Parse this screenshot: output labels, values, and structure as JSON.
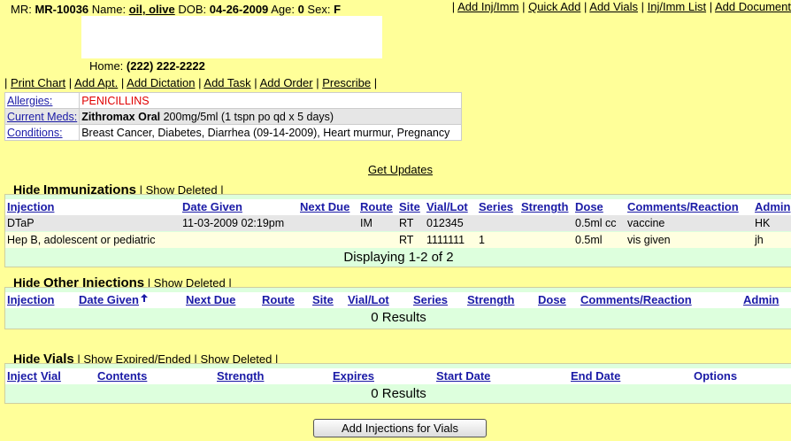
{
  "patient": {
    "mr_label": "MR:",
    "mr": "MR-10036",
    "name_label": "Name:",
    "name": "oil, olive",
    "dob_label": "DOB:",
    "dob": "04-26-2009",
    "age_label": "Age:",
    "age": "0",
    "sex_label": "Sex:",
    "sex": "F",
    "home_label": "Home:",
    "home": "(222) 222-2222"
  },
  "top_links": [
    "Add Inj/Imm",
    "Quick Add",
    "Add Vials",
    "Inj/Imm List",
    "Add Document"
  ],
  "action_links": [
    "Print Chart",
    "Add Apt.",
    "Add Dictation",
    "Add Task",
    "Add Order",
    "Prescribe"
  ],
  "info": {
    "allergies_label": "Allergies:",
    "allergies": "PENICILLINS",
    "meds_label": "Current Meds:",
    "meds_name": "Zithromax Oral",
    "meds_detail": " 200mg/5ml (1 tspn po qd x 5 days)",
    "conditions_label": "Conditions:",
    "conditions": "Breast Cancer, Diabetes, Diarrhea (09-14-2009), Heart murmur, Pregnancy"
  },
  "get_updates": "Get Updates",
  "immunizations": {
    "hide": "Hide",
    "title": "Immunizations",
    "show_deleted": "Show Deleted",
    "columns": [
      "Injection",
      "Date Given",
      "Next Due",
      "Route",
      "Site",
      "Vial/Lot",
      "Series",
      "Strength",
      "Dose",
      "Comments/Reaction",
      "Admin"
    ],
    "rows": [
      {
        "injection": "DTaP",
        "date_given": "11-03-2009 02:19pm",
        "next_due": "",
        "route": "IM",
        "site": "RT",
        "vial_lot": "012345",
        "series": "",
        "strength": "",
        "dose": "0.5ml cc",
        "comments": "vaccine",
        "admin": "HK"
      },
      {
        "injection": "Hep B, adolescent or pediatric",
        "date_given": "",
        "next_due": "",
        "route": "",
        "site": "RT",
        "vial_lot": "1111111",
        "series": "1",
        "strength": "",
        "dose": "0.5ml",
        "comments": "vis given",
        "admin": "jh"
      }
    ],
    "footer": "Displaying 1-2 of 2"
  },
  "other_injections": {
    "hide": "Hide",
    "title": "Other Injections",
    "show_deleted": "Show Deleted",
    "columns": [
      "Injection",
      "Date Given",
      "Next Due",
      "Route",
      "Site",
      "Vial/Lot",
      "Series",
      "Strength",
      "Dose",
      "Comments/Reaction",
      "Admin"
    ],
    "sort_icon": "sort-arrow-icon",
    "footer": "0 Results"
  },
  "vials": {
    "hide": "Hide",
    "title": "Vials",
    "show_expired": "Show Expired/Ended",
    "show_deleted": "Show Deleted",
    "columns": [
      "Inject",
      "Vial",
      "Contents",
      "Strength",
      "Expires",
      "Start Date",
      "End Date",
      "Options"
    ],
    "footer": "0 Results"
  },
  "add_button": "Add Injections for Vials"
}
